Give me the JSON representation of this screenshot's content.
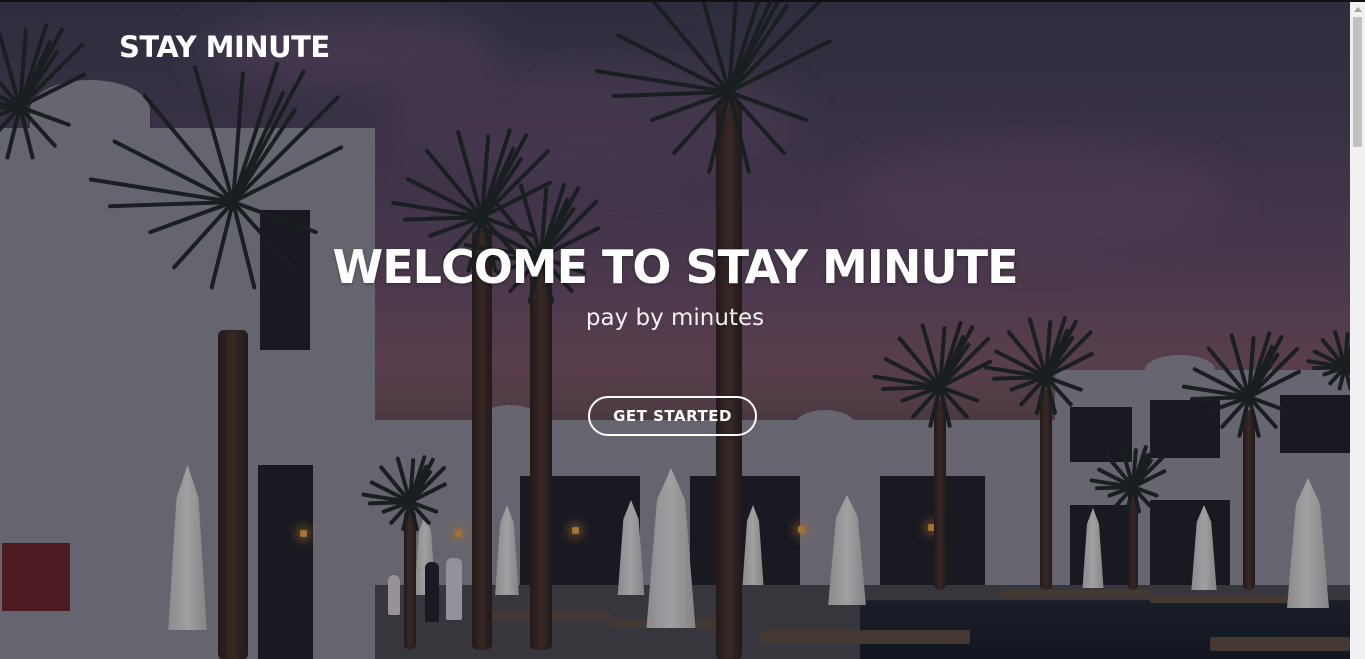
{
  "brand": {
    "name": "STAY MINUTE"
  },
  "hero": {
    "title": "WELCOME TO STAY MINUTE",
    "subtitle": "pay by minutes",
    "cta_label": "GET STARTED",
    "background_description_icon": "hotel-pool-palm-trees-image"
  },
  "colors": {
    "text": "#ffffff",
    "overlay": "#14121e",
    "button_border": "#ffffff"
  }
}
